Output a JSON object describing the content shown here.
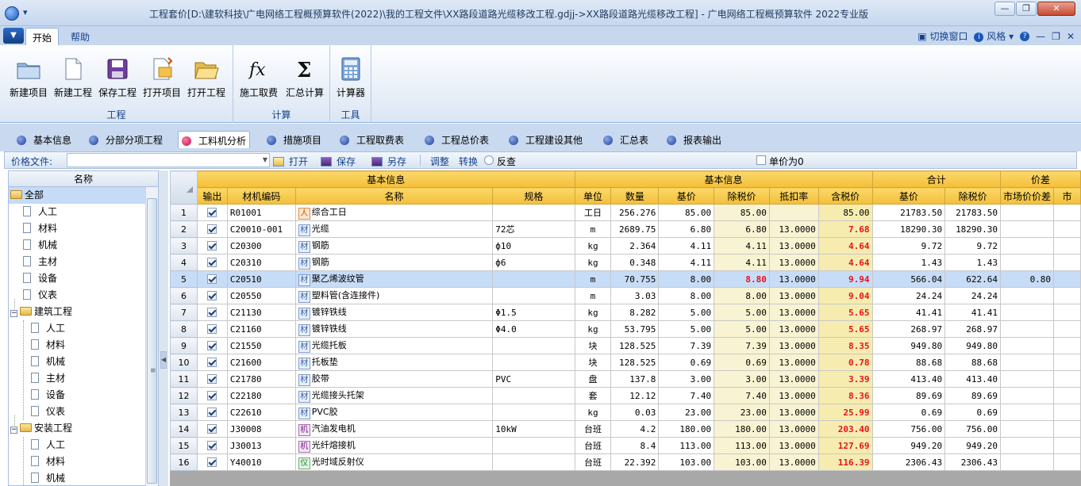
{
  "window": {
    "title": "工程套价[D:\\建软科技\\广电网络工程概预算软件(2022)\\我的工程文件\\XX路段道路光缆移改工程.gdjj->XX路段道路光缆移改工程] - 广电网络工程概预算软件 2022专业版",
    "quick_access": "▾"
  },
  "ribbon_tabs": [
    {
      "label": "开始"
    },
    {
      "label": "帮助"
    }
  ],
  "ribbon_right": {
    "switch_window": "切换窗口",
    "style": "风格",
    "style_arrow": "▾"
  },
  "ribbon_groups": {
    "project": {
      "title": "工程",
      "buttons": [
        {
          "label": "新建项目"
        },
        {
          "label": "新建工程"
        },
        {
          "label": "保存工程"
        },
        {
          "label": "打开项目"
        },
        {
          "label": "打开工程"
        }
      ]
    },
    "calc": {
      "title": "计算",
      "buttons": [
        {
          "label": "施工取费"
        },
        {
          "label": "汇总计算"
        }
      ]
    },
    "tools": {
      "title": "工具",
      "buttons": [
        {
          "label": "计算器"
        }
      ]
    }
  },
  "nav_tabs": [
    {
      "label": "基本信息"
    },
    {
      "label": "分部分项工程"
    },
    {
      "label": "工料机分析"
    },
    {
      "label": "措施项目"
    },
    {
      "label": "工程取费表"
    },
    {
      "label": "工程总价表"
    },
    {
      "label": "工程建设其他"
    },
    {
      "label": "汇总表"
    },
    {
      "label": "报表输出"
    }
  ],
  "toolbar": {
    "price_file_label": "价格文件:",
    "price_file_value": "",
    "open": "打开",
    "save": "保存",
    "save_as": "另存",
    "adjust": "调整",
    "convert": "转换",
    "reverse": "反查",
    "unit_price_zero": "单价为0"
  },
  "tree": {
    "header": "名称",
    "nodes": [
      {
        "label": "全部"
      },
      {
        "label": "人工"
      },
      {
        "label": "材料"
      },
      {
        "label": "机械"
      },
      {
        "label": "主材"
      },
      {
        "label": "设备"
      },
      {
        "label": "仪表"
      },
      {
        "label": "建筑工程"
      },
      {
        "label": "人工"
      },
      {
        "label": "材料"
      },
      {
        "label": "机械"
      },
      {
        "label": "主材"
      },
      {
        "label": "设备"
      },
      {
        "label": "仪表"
      },
      {
        "label": "安装工程"
      },
      {
        "label": "人工"
      },
      {
        "label": "材料"
      },
      {
        "label": "机械"
      }
    ]
  },
  "grid": {
    "group_headers": {
      "basic1": "基本信息",
      "basic2": "基本信息",
      "total": "合计",
      "diff": "价差"
    },
    "columns": [
      "输出",
      "材机编码",
      "名称",
      "规格",
      "单位",
      "数量",
      "基价",
      "除税价",
      "抵扣率",
      "含税价",
      "基价",
      "除税价",
      "市场价价差",
      "市"
    ],
    "rows": [
      {
        "no": "1",
        "code": "R01001",
        "type": "人",
        "name": "综合工日",
        "spec": "",
        "unit": "工日",
        "qty": "256.276",
        "base": "85.00",
        "notax": "85.00",
        "rate": "",
        "tax": "85.00",
        "sum_base": "21783.50",
        "sum_notax": "21783.50",
        "diff": ""
      },
      {
        "no": "2",
        "code": "C20010-001",
        "type": "材",
        "name": "光缆",
        "spec": "72芯",
        "unit": "m",
        "qty": "2689.75",
        "base": "6.80",
        "notax": "6.80",
        "rate": "13.0000",
        "tax": "7.68",
        "sum_base": "18290.30",
        "sum_notax": "18290.30",
        "diff": ""
      },
      {
        "no": "3",
        "code": "C20300",
        "type": "材",
        "name": "钢筋",
        "spec": "ф10",
        "unit": "kg",
        "qty": "2.364",
        "base": "4.11",
        "notax": "4.11",
        "rate": "13.0000",
        "tax": "4.64",
        "sum_base": "9.72",
        "sum_notax": "9.72",
        "diff": ""
      },
      {
        "no": "4",
        "code": "C20310",
        "type": "材",
        "name": "钢筋",
        "spec": "ф6",
        "unit": "kg",
        "qty": "0.348",
        "base": "4.11",
        "notax": "4.11",
        "rate": "13.0000",
        "tax": "4.64",
        "sum_base": "1.43",
        "sum_notax": "1.43",
        "diff": ""
      },
      {
        "no": "5",
        "code": "C20510",
        "type": "材",
        "name": "聚乙烯波纹管",
        "spec": "",
        "unit": "m",
        "qty": "70.755",
        "base": "8.00",
        "notax": "8.80",
        "rate": "13.0000",
        "tax": "9.94",
        "sum_base": "566.04",
        "sum_notax": "622.64",
        "diff": "0.80"
      },
      {
        "no": "6",
        "code": "C20550",
        "type": "材",
        "name": "塑料管(含连接件)",
        "spec": "",
        "unit": "m",
        "qty": "3.03",
        "base": "8.00",
        "notax": "8.00",
        "rate": "13.0000",
        "tax": "9.04",
        "sum_base": "24.24",
        "sum_notax": "24.24",
        "diff": ""
      },
      {
        "no": "7",
        "code": "C21130",
        "type": "材",
        "name": "镀锌铁线",
        "spec": "Φ1.5",
        "unit": "kg",
        "qty": "8.282",
        "base": "5.00",
        "notax": "5.00",
        "rate": "13.0000",
        "tax": "5.65",
        "sum_base": "41.41",
        "sum_notax": "41.41",
        "diff": ""
      },
      {
        "no": "8",
        "code": "C21160",
        "type": "材",
        "name": "镀锌铁线",
        "spec": "Φ4.0",
        "unit": "kg",
        "qty": "53.795",
        "base": "5.00",
        "notax": "5.00",
        "rate": "13.0000",
        "tax": "5.65",
        "sum_base": "268.97",
        "sum_notax": "268.97",
        "diff": ""
      },
      {
        "no": "9",
        "code": "C21550",
        "type": "材",
        "name": "光缆托板",
        "spec": "",
        "unit": "块",
        "qty": "128.525",
        "base": "7.39",
        "notax": "7.39",
        "rate": "13.0000",
        "tax": "8.35",
        "sum_base": "949.80",
        "sum_notax": "949.80",
        "diff": ""
      },
      {
        "no": "10",
        "code": "C21600",
        "type": "材",
        "name": "托板垫",
        "spec": "",
        "unit": "块",
        "qty": "128.525",
        "base": "0.69",
        "notax": "0.69",
        "rate": "13.0000",
        "tax": "0.78",
        "sum_base": "88.68",
        "sum_notax": "88.68",
        "diff": ""
      },
      {
        "no": "11",
        "code": "C21780",
        "type": "材",
        "name": "胶带",
        "spec": "PVC",
        "unit": "盘",
        "qty": "137.8",
        "base": "3.00",
        "notax": "3.00",
        "rate": "13.0000",
        "tax": "3.39",
        "sum_base": "413.40",
        "sum_notax": "413.40",
        "diff": ""
      },
      {
        "no": "12",
        "code": "C22180",
        "type": "材",
        "name": "光缆接头托架",
        "spec": "",
        "unit": "套",
        "qty": "12.12",
        "base": "7.40",
        "notax": "7.40",
        "rate": "13.0000",
        "tax": "8.36",
        "sum_base": "89.69",
        "sum_notax": "89.69",
        "diff": ""
      },
      {
        "no": "13",
        "code": "C22610",
        "type": "材",
        "name": "PVC胶",
        "spec": "",
        "unit": "kg",
        "qty": "0.03",
        "base": "23.00",
        "notax": "23.00",
        "rate": "13.0000",
        "tax": "25.99",
        "sum_base": "0.69",
        "sum_notax": "0.69",
        "diff": ""
      },
      {
        "no": "14",
        "code": "J30008",
        "type": "机",
        "name": "汽油发电机",
        "spec": "10kW",
        "unit": "台班",
        "qty": "4.2",
        "base": "180.00",
        "notax": "180.00",
        "rate": "13.0000",
        "tax": "203.40",
        "sum_base": "756.00",
        "sum_notax": "756.00",
        "diff": ""
      },
      {
        "no": "15",
        "code": "J30013",
        "type": "机",
        "name": "光纤熔接机",
        "spec": "",
        "unit": "台班",
        "qty": "8.4",
        "base": "113.00",
        "notax": "113.00",
        "rate": "13.0000",
        "tax": "127.69",
        "sum_base": "949.20",
        "sum_notax": "949.20",
        "diff": ""
      },
      {
        "no": "16",
        "code": "Y40010",
        "type": "仪",
        "name": "光时域反射仪",
        "spec": "",
        "unit": "台班",
        "qty": "22.392",
        "base": "103.00",
        "notax": "103.00",
        "rate": "13.0000",
        "tax": "116.39",
        "sum_base": "2306.43",
        "sum_notax": "2306.43",
        "diff": ""
      }
    ]
  }
}
